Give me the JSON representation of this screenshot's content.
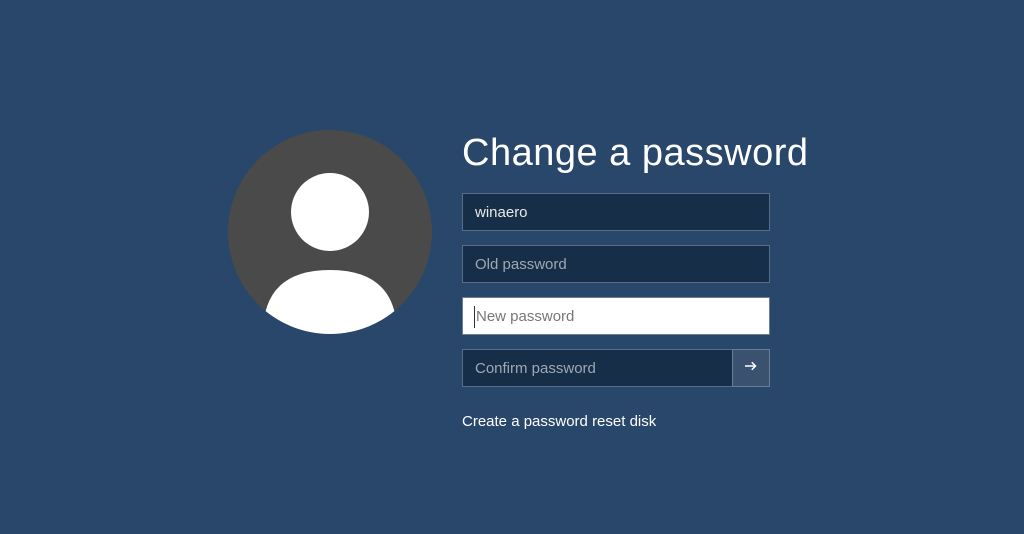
{
  "title": "Change a password",
  "username": "winaero",
  "placeholders": {
    "old_password": "Old password",
    "new_password": "New password",
    "confirm_password": "Confirm password"
  },
  "link_text": "Create a password reset disk",
  "icons": {
    "submit": "arrow-right-icon",
    "avatar": "user-avatar-icon"
  },
  "colors": {
    "background": "#28476a",
    "field_bg": "#172e48",
    "field_active_bg": "#ffffff",
    "avatar_bg": "#4a4a4a"
  }
}
